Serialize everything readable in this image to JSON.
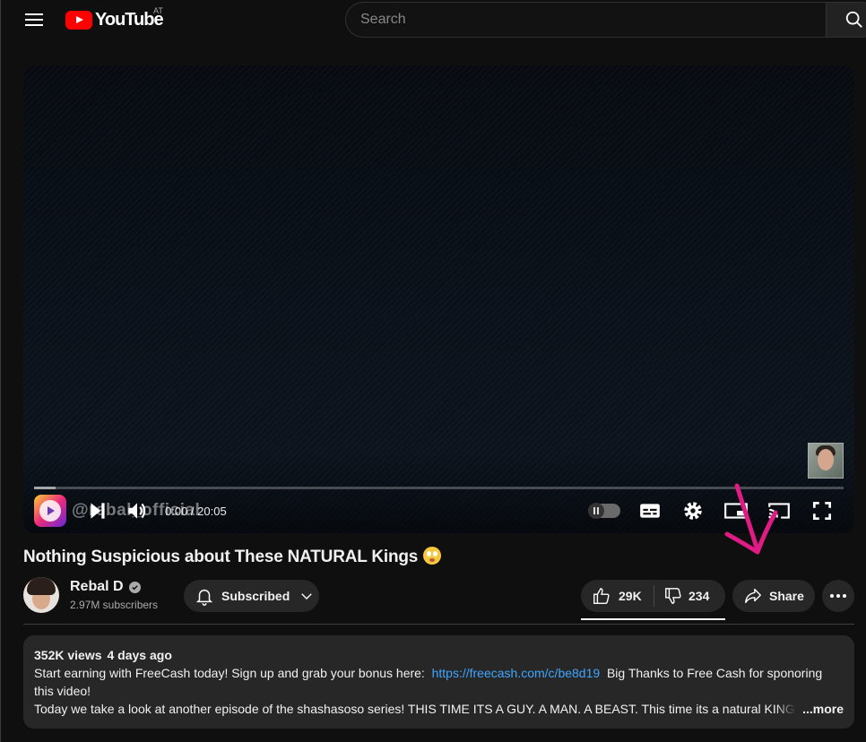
{
  "header": {
    "logo_text": "YouTube",
    "country_code": "AT",
    "search_placeholder": "Search"
  },
  "player": {
    "watermark": "@rebal_official",
    "time_current": "0:00",
    "time_total": "20:05",
    "time_display": "0:00 / 20:05",
    "progress_fraction": 0.0,
    "autoplay_on": false
  },
  "video": {
    "title": "Nothing Suspicious about These NATURAL Kings",
    "title_emoji": "flushed-face-emoji"
  },
  "channel": {
    "name": "Rebal D",
    "verified": true,
    "subscribers": "2.97M subscribers",
    "subscribe_label": "Subscribed"
  },
  "actions": {
    "likes": "29K",
    "dislikes": "234",
    "share_label": "Share"
  },
  "description": {
    "views": "352K views",
    "date": "4 days ago",
    "line1_prefix": "Start earning with FreeCash today! Sign up and grab your bonus here:",
    "link": "https://freecash.com/c/be8d19",
    "line1_suffix": "Big Thanks to Free Cash for sponoring this video!",
    "line3": "Today we take a look at another episode of the shashasoso series! THIS TIME ITS A GUY. A MAN. A BEAST. This time its a natural KING no",
    "more_label": "...more"
  },
  "colors": {
    "background": "#0f0f0f",
    "pill": "#272727",
    "brand_red": "#ff0000",
    "link": "#3ea6ff",
    "annotation": "#e01b84"
  }
}
